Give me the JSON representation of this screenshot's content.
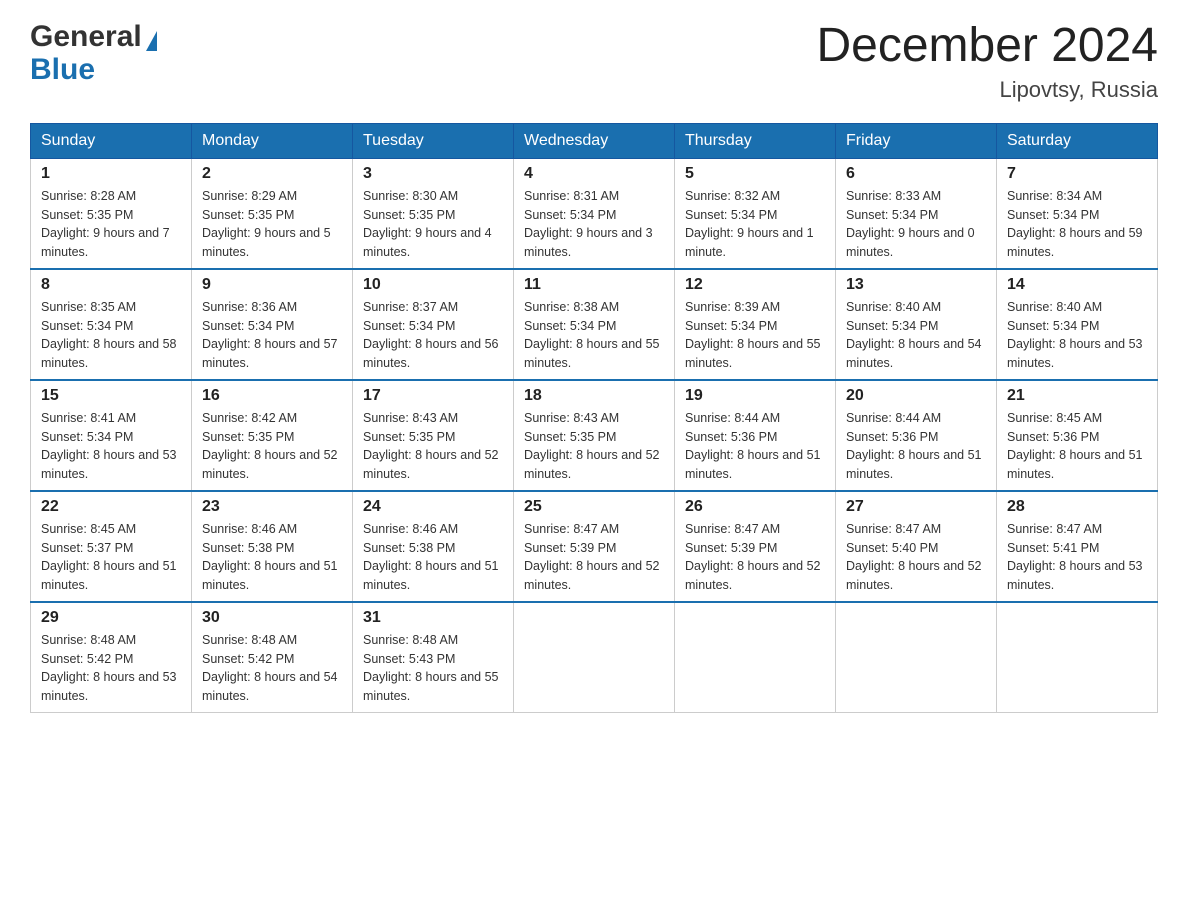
{
  "header": {
    "logo_general": "General",
    "logo_blue": "Blue",
    "month_year": "December 2024",
    "location": "Lipovtsy, Russia"
  },
  "days_of_week": [
    "Sunday",
    "Monday",
    "Tuesday",
    "Wednesday",
    "Thursday",
    "Friday",
    "Saturday"
  ],
  "weeks": [
    [
      {
        "day": "1",
        "sunrise": "8:28 AM",
        "sunset": "5:35 PM",
        "daylight": "9 hours and 7 minutes."
      },
      {
        "day": "2",
        "sunrise": "8:29 AM",
        "sunset": "5:35 PM",
        "daylight": "9 hours and 5 minutes."
      },
      {
        "day": "3",
        "sunrise": "8:30 AM",
        "sunset": "5:35 PM",
        "daylight": "9 hours and 4 minutes."
      },
      {
        "day": "4",
        "sunrise": "8:31 AM",
        "sunset": "5:34 PM",
        "daylight": "9 hours and 3 minutes."
      },
      {
        "day": "5",
        "sunrise": "8:32 AM",
        "sunset": "5:34 PM",
        "daylight": "9 hours and 1 minute."
      },
      {
        "day": "6",
        "sunrise": "8:33 AM",
        "sunset": "5:34 PM",
        "daylight": "9 hours and 0 minutes."
      },
      {
        "day": "7",
        "sunrise": "8:34 AM",
        "sunset": "5:34 PM",
        "daylight": "8 hours and 59 minutes."
      }
    ],
    [
      {
        "day": "8",
        "sunrise": "8:35 AM",
        "sunset": "5:34 PM",
        "daylight": "8 hours and 58 minutes."
      },
      {
        "day": "9",
        "sunrise": "8:36 AM",
        "sunset": "5:34 PM",
        "daylight": "8 hours and 57 minutes."
      },
      {
        "day": "10",
        "sunrise": "8:37 AM",
        "sunset": "5:34 PM",
        "daylight": "8 hours and 56 minutes."
      },
      {
        "day": "11",
        "sunrise": "8:38 AM",
        "sunset": "5:34 PM",
        "daylight": "8 hours and 55 minutes."
      },
      {
        "day": "12",
        "sunrise": "8:39 AM",
        "sunset": "5:34 PM",
        "daylight": "8 hours and 55 minutes."
      },
      {
        "day": "13",
        "sunrise": "8:40 AM",
        "sunset": "5:34 PM",
        "daylight": "8 hours and 54 minutes."
      },
      {
        "day": "14",
        "sunrise": "8:40 AM",
        "sunset": "5:34 PM",
        "daylight": "8 hours and 53 minutes."
      }
    ],
    [
      {
        "day": "15",
        "sunrise": "8:41 AM",
        "sunset": "5:34 PM",
        "daylight": "8 hours and 53 minutes."
      },
      {
        "day": "16",
        "sunrise": "8:42 AM",
        "sunset": "5:35 PM",
        "daylight": "8 hours and 52 minutes."
      },
      {
        "day": "17",
        "sunrise": "8:43 AM",
        "sunset": "5:35 PM",
        "daylight": "8 hours and 52 minutes."
      },
      {
        "day": "18",
        "sunrise": "8:43 AM",
        "sunset": "5:35 PM",
        "daylight": "8 hours and 52 minutes."
      },
      {
        "day": "19",
        "sunrise": "8:44 AM",
        "sunset": "5:36 PM",
        "daylight": "8 hours and 51 minutes."
      },
      {
        "day": "20",
        "sunrise": "8:44 AM",
        "sunset": "5:36 PM",
        "daylight": "8 hours and 51 minutes."
      },
      {
        "day": "21",
        "sunrise": "8:45 AM",
        "sunset": "5:36 PM",
        "daylight": "8 hours and 51 minutes."
      }
    ],
    [
      {
        "day": "22",
        "sunrise": "8:45 AM",
        "sunset": "5:37 PM",
        "daylight": "8 hours and 51 minutes."
      },
      {
        "day": "23",
        "sunrise": "8:46 AM",
        "sunset": "5:38 PM",
        "daylight": "8 hours and 51 minutes."
      },
      {
        "day": "24",
        "sunrise": "8:46 AM",
        "sunset": "5:38 PM",
        "daylight": "8 hours and 51 minutes."
      },
      {
        "day": "25",
        "sunrise": "8:47 AM",
        "sunset": "5:39 PM",
        "daylight": "8 hours and 52 minutes."
      },
      {
        "day": "26",
        "sunrise": "8:47 AM",
        "sunset": "5:39 PM",
        "daylight": "8 hours and 52 minutes."
      },
      {
        "day": "27",
        "sunrise": "8:47 AM",
        "sunset": "5:40 PM",
        "daylight": "8 hours and 52 minutes."
      },
      {
        "day": "28",
        "sunrise": "8:47 AM",
        "sunset": "5:41 PM",
        "daylight": "8 hours and 53 minutes."
      }
    ],
    [
      {
        "day": "29",
        "sunrise": "8:48 AM",
        "sunset": "5:42 PM",
        "daylight": "8 hours and 53 minutes."
      },
      {
        "day": "30",
        "sunrise": "8:48 AM",
        "sunset": "5:42 PM",
        "daylight": "8 hours and 54 minutes."
      },
      {
        "day": "31",
        "sunrise": "8:48 AM",
        "sunset": "5:43 PM",
        "daylight": "8 hours and 55 minutes."
      },
      null,
      null,
      null,
      null
    ]
  ]
}
